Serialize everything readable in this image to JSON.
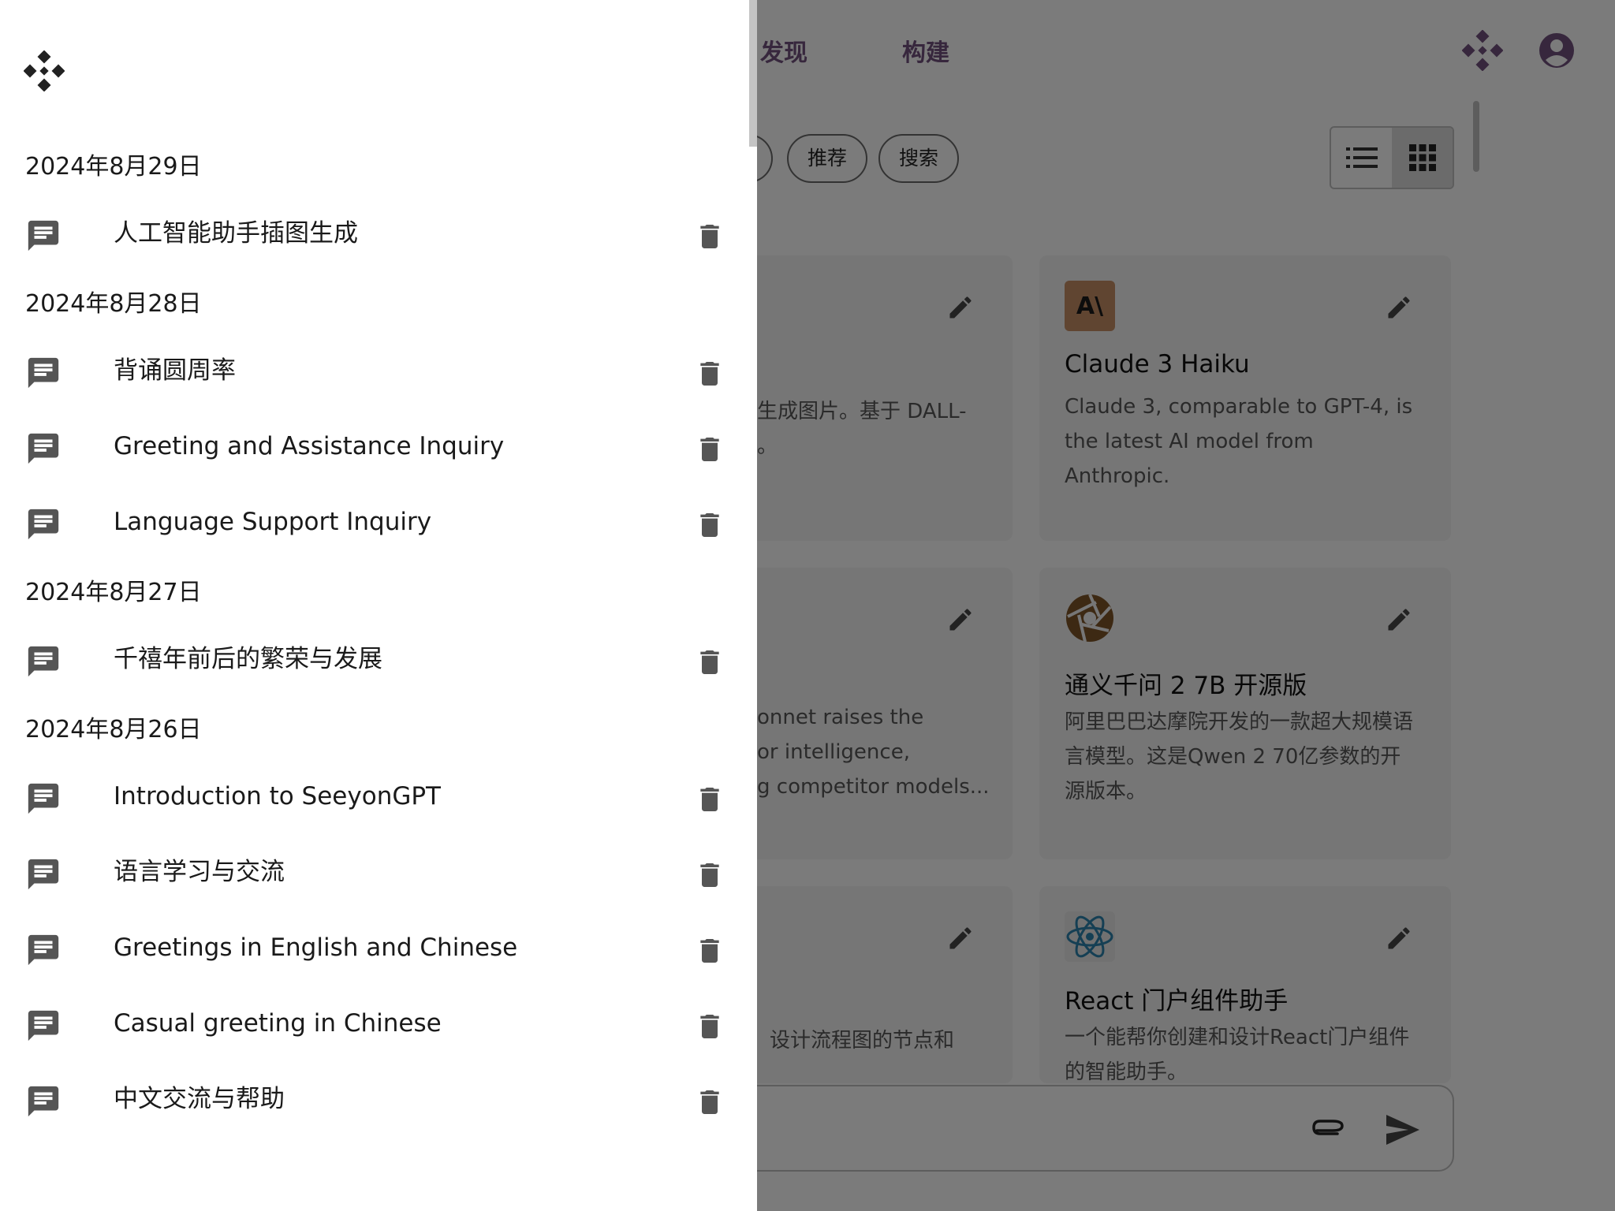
{
  "nav": {
    "discover": "发现",
    "build": "构建"
  },
  "filters": {
    "recommend": "推荐",
    "search": "搜索"
  },
  "icons": {
    "logo": "seeyon-logo-icon",
    "account": "account-circle-icon",
    "list_view": "list-icon",
    "grid_view": "grid-icon",
    "edit": "pencil-icon",
    "chat": "chat-bubble-icon",
    "delete": "trash-icon",
    "attach": "paperclip-icon",
    "send": "send-icon"
  },
  "cards": {
    "c1": {
      "desc_fragment_1": "生成图片。基于 DALL-",
      "desc_fragment_2": "。"
    },
    "c2": {
      "logo_text": "A\\",
      "title": "Claude 3 Haiku",
      "desc": "Claude 3, comparable to GPT-4, is the latest AI model from Anthropic."
    },
    "c3": {
      "desc_fragment_1": "onnet raises the",
      "desc_fragment_2": "or intelligence,",
      "desc_fragment_3": "g competitor models..."
    },
    "c4": {
      "title": "通义千问 2 7B 开源版",
      "desc": "阿里巴巴达摩院开发的一款超大规模语言模型。这是Qwen 2 70亿参数的开源版本。"
    },
    "c5": {
      "desc_fragment_1": "，设计流程图的节点和"
    },
    "c6": {
      "title": "React 门户组件助手",
      "desc": "一个能帮你创建和设计React门户组件的智能助手。"
    }
  },
  "colors": {
    "claude_logo_bg": "#c08a62",
    "qwen_logo": "#7b5227",
    "react_logo": "#2a7fa8",
    "nav_accent": "#6e4f7a"
  },
  "drawer": {
    "groups": [
      {
        "date": "2024年8月29日",
        "items": [
          "人工智能助手插图生成"
        ]
      },
      {
        "date": "2024年8月28日",
        "items": [
          "背诵圆周率",
          "Greeting and Assistance Inquiry",
          "Language Support Inquiry"
        ]
      },
      {
        "date": "2024年8月27日",
        "items": [
          "千禧年前后的繁荣与发展"
        ]
      },
      {
        "date": "2024年8月26日",
        "items": [
          "Introduction to SeeyonGPT",
          "语言学习与交流",
          "Greetings in English and Chinese",
          "Casual greeting in Chinese",
          "中文交流与帮助"
        ]
      }
    ]
  }
}
